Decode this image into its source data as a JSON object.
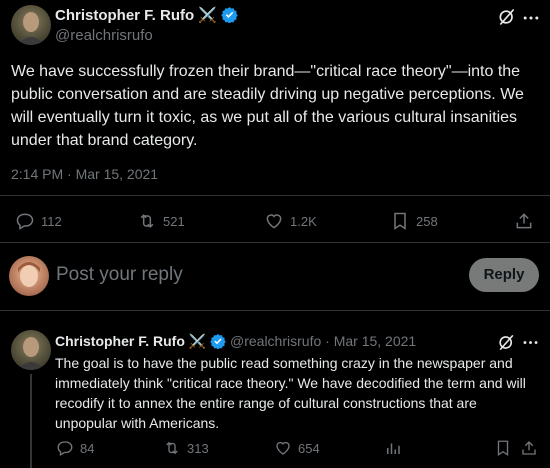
{
  "main_tweet": {
    "author_name": "Christopher F. Rufo",
    "name_emoji": "⚔️",
    "handle": "@realchrisrufo",
    "text": "We have successfully frozen their brand—\"critical race theory\"—into the public conversation and are steadily driving up negative perceptions. We will eventually turn it toxic, as we put all of the various cultural insanities under that brand category.",
    "timestamp": "2:14 PM · Mar 15, 2021",
    "replies": "112",
    "retweets": "521",
    "likes": "1.2K",
    "bookmarks": "258"
  },
  "reply_box": {
    "placeholder": "Post your reply",
    "button": "Reply"
  },
  "thread_reply": {
    "author_name": "Christopher F. Rufo",
    "name_emoji": "⚔️",
    "handle": "@realchrisrufo",
    "date": "· Mar 15, 2021",
    "text": "The goal is to have the public read something crazy in the newspaper and immediately think \"critical race theory.\" We have decodified the term and will recodify it to annex the entire range of cultural constructions that are unpopular with Americans.",
    "replies": "84",
    "retweets": "313",
    "likes": "654"
  },
  "colors": {
    "accent": "#1d9bf0",
    "muted": "#71767b",
    "text": "#e7e9ea",
    "button_bg": "#eff3f4"
  }
}
